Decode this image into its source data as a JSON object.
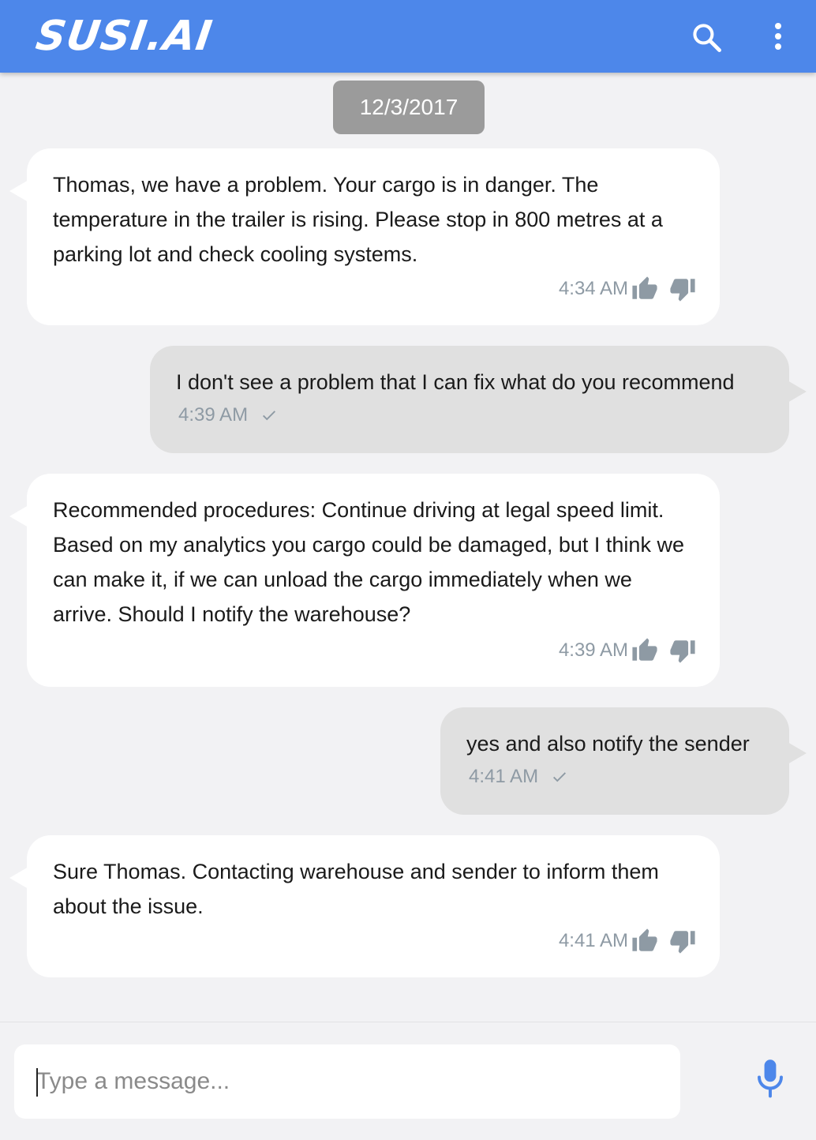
{
  "app": {
    "brand": "SUSI.AI",
    "header_color": "#4d87ea"
  },
  "date_label": "12/3/2017",
  "messages": [
    {
      "sender": "susi",
      "text": "Thomas, we have a problem. Your cargo is in danger. The temperature in the trailer is rising. Please stop in 800 metres at a parking lot and check cooling systems.",
      "time": "4:34 AM"
    },
    {
      "sender": "user",
      "text": "I don't see a problem that I can fix what do you recommend",
      "time": "4:39 AM"
    },
    {
      "sender": "susi",
      "text": "Recommended procedures: Continue driving at legal speed limit. Based on my analytics you cargo could be damaged, but I think we can make it, if we can unload the cargo immediately when we arrive. Should I notify the warehouse?",
      "time": "4:39 AM"
    },
    {
      "sender": "user",
      "text": "yes and also notify the sender",
      "time": "4:41 AM"
    },
    {
      "sender": "susi",
      "text": "Sure Thomas. Contacting warehouse and sender to inform them about the issue.",
      "time": "4:41 AM"
    }
  ],
  "composer": {
    "placeholder": "Type a message..."
  },
  "icons": {
    "search": "search-icon",
    "menu": "more-vert-icon",
    "thumbs_up": "thumbs-up-icon",
    "thumbs_down": "thumbs-down-icon",
    "check": "check-icon",
    "mic": "microphone-icon"
  },
  "colors": {
    "accent": "#4d87ea",
    "user_bubble": "#e0e0e0",
    "susi_bubble": "#ffffff"
  }
}
